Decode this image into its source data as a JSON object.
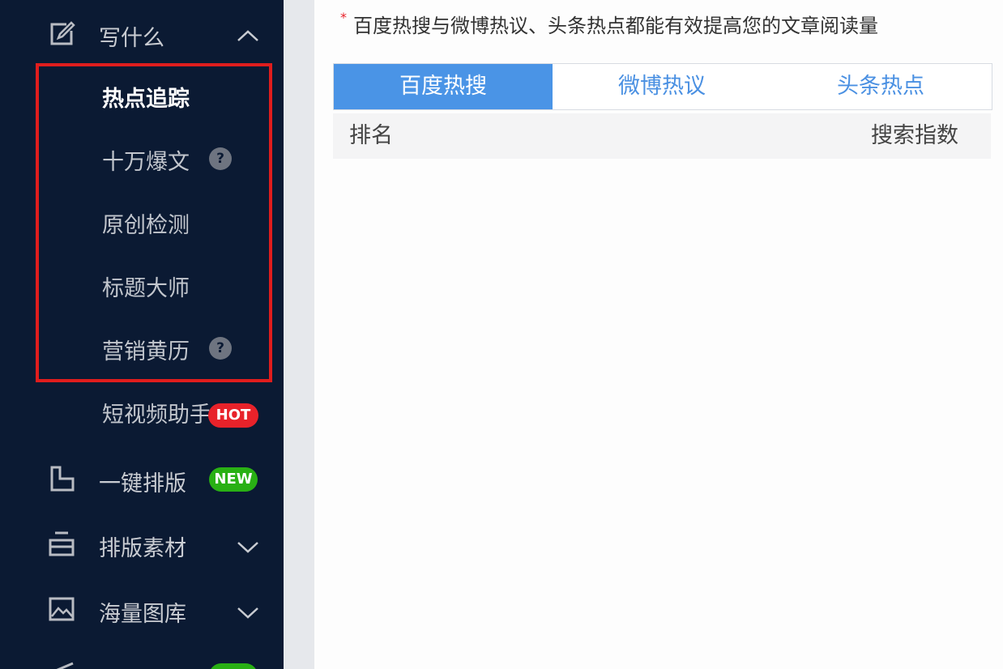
{
  "sidebar": {
    "write_menu": {
      "label": "写什么",
      "icon": "edit-icon"
    },
    "sub_items": [
      {
        "label": "热点追踪"
      },
      {
        "label": "十万爆文",
        "help": "?"
      },
      {
        "label": "原创检测"
      },
      {
        "label": "标题大师"
      },
      {
        "label": "营销黄历",
        "help": "?"
      },
      {
        "label": "短视频助手",
        "badge": "HOT"
      }
    ],
    "layout_item": {
      "label": "一键排版",
      "badge": "NEW",
      "icon": "layout-icon"
    },
    "material_item": {
      "label": "排版素材",
      "icon": "material-icon"
    },
    "gallery_item": {
      "label": "海量图库",
      "icon": "image-icon"
    }
  },
  "main": {
    "notice": {
      "star": "*",
      "text": "百度热搜与微博热议、头条热点都能有效提高您的文章阅读量"
    },
    "tabs": [
      {
        "label": "百度热搜",
        "active": true
      },
      {
        "label": "微博热议",
        "active": false
      },
      {
        "label": "头条热点",
        "active": false
      }
    ],
    "table": {
      "col_rank": "排名",
      "col_index": "搜索指数"
    }
  },
  "colors": {
    "sidebar_bg": "#0b1a33",
    "active_tab": "#4a94e6",
    "tab_text": "#4a90e2",
    "highlight_border": "#e01d1d",
    "hot_badge": "#e8222a",
    "new_badge": "#29b014"
  }
}
